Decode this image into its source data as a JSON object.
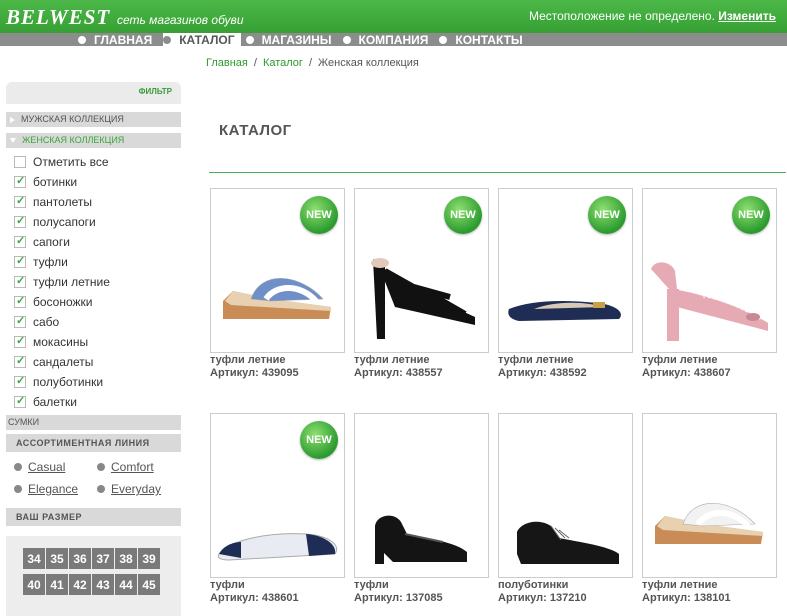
{
  "header": {
    "logo": "BELWEST",
    "tagline": "сеть магазинов обуви",
    "location_text": "Местоположение не определено.",
    "location_link": "Изменить"
  },
  "nav": {
    "items": [
      {
        "label": "ГЛАВНАЯ"
      },
      {
        "label": "КАТАЛОГ"
      },
      {
        "label": "МАГАЗИНЫ"
      },
      {
        "label": "КОМПАНИЯ"
      },
      {
        "label": "КОНТАКТЫ"
      }
    ]
  },
  "breadcrumb": {
    "home": "Главная",
    "catalog": "Каталог",
    "current": "Женская коллекция"
  },
  "sidebar": {
    "filter_label": "ФИЛЬТР",
    "men_collection": "МУЖСКАЯ КОЛЛЕКЦИЯ",
    "women_collection": "ЖЕНСКАЯ КОЛЛЕКЦИЯ",
    "checkboxes": [
      {
        "label": "Отметить все",
        "checked": false
      },
      {
        "label": "ботинки",
        "checked": true
      },
      {
        "label": "пантолеты",
        "checked": true
      },
      {
        "label": "полусапоги",
        "checked": true
      },
      {
        "label": "сапоги",
        "checked": true
      },
      {
        "label": "туфли",
        "checked": true
      },
      {
        "label": "туфли летние",
        "checked": true
      },
      {
        "label": "босоножки",
        "checked": true
      },
      {
        "label": "сабо",
        "checked": true
      },
      {
        "label": "мокасины",
        "checked": true
      },
      {
        "label": "сандалеты",
        "checked": true
      },
      {
        "label": "полуботинки",
        "checked": true
      },
      {
        "label": "балетки",
        "checked": true
      }
    ],
    "bags": "СУМКИ",
    "assortment_title": "АССОРТИМЕНТНАЯ ЛИНИЯ",
    "lines": [
      "Casual",
      "Comfort",
      "Elegance",
      "Everyday"
    ],
    "size_title": "ВАШ РАЗМЕР",
    "sizes": [
      "34",
      "35",
      "36",
      "37",
      "38",
      "39",
      "40",
      "41",
      "42",
      "43",
      "44",
      "45"
    ]
  },
  "catalog": {
    "title": "КАТАЛОГ",
    "new_badge": "NEW",
    "products": [
      {
        "name": "туфли летние",
        "article": "Артикул: 439095",
        "is_new": true,
        "shoe_icon": "wedge-sandal-icon",
        "color": "#6f8fc8"
      },
      {
        "name": "туфли летние",
        "article": "Артикул: 438557",
        "is_new": true,
        "shoe_icon": "heel-sandal-icon",
        "color": "#111111"
      },
      {
        "name": "туфли летние",
        "article": "Артикул: 438592",
        "is_new": true,
        "shoe_icon": "flat-shoe-icon",
        "color": "#1f2d55"
      },
      {
        "name": "туфли летние",
        "article": "Артикул: 438607",
        "is_new": true,
        "shoe_icon": "heel-slingback-icon",
        "color": "#e6aab5"
      },
      {
        "name": "туфли",
        "article": "Артикул: 438601",
        "is_new": true,
        "shoe_icon": "ballet-flat-icon",
        "color": "#e8ecf2"
      },
      {
        "name": "туфли",
        "article": "Артикул: 137085",
        "is_new": false,
        "shoe_icon": "heeled-shoe-icon",
        "color": "#141414"
      },
      {
        "name": "полуботинки",
        "article": "Артикул: 137210",
        "is_new": false,
        "shoe_icon": "oxford-shoe-icon",
        "color": "#161616"
      },
      {
        "name": "туфли летние",
        "article": "Артикул: 138101",
        "is_new": false,
        "shoe_icon": "wedge-sandal-icon",
        "color": "#f2f2f2"
      }
    ]
  }
}
